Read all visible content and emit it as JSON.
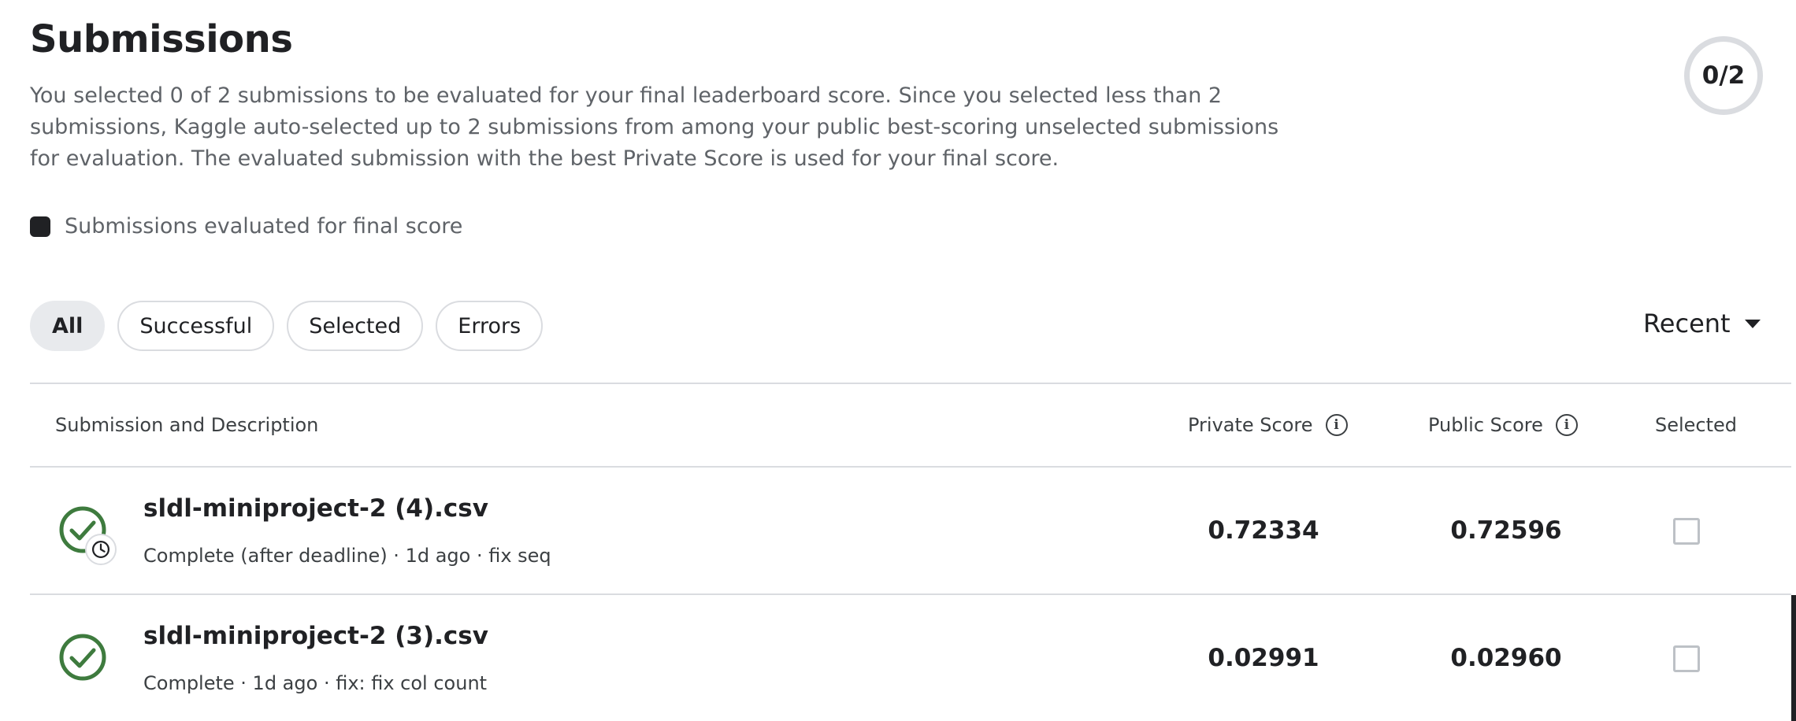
{
  "header": {
    "title": "Submissions",
    "description": "You selected 0 of 2 submissions to be evaluated for your final leaderboard score. Since you selected less than 2 submissions, Kaggle auto-selected up to 2 submissions from among your public best-scoring unselected submissions for evaluation. The evaluated submission with the best Private Score is used for your final score.",
    "counter": "0/2"
  },
  "legend": {
    "label": "Submissions evaluated for final score",
    "swatch_color": "#202124"
  },
  "filters": [
    {
      "label": "All",
      "active": true
    },
    {
      "label": "Successful",
      "active": false
    },
    {
      "label": "Selected",
      "active": false
    },
    {
      "label": "Errors",
      "active": false
    }
  ],
  "sort": {
    "label": "Recent",
    "icon": "caret-down-icon"
  },
  "table": {
    "columns": {
      "submission": "Submission and Description",
      "private_score": "Private Score",
      "public_score": "Public Score",
      "selected": "Selected"
    },
    "rows": [
      {
        "title": "sldl-miniproject-2 (4).csv",
        "meta": "Complete (after deadline) · 1d ago · fix seq",
        "private_score": "0.72334",
        "public_score": "0.72596",
        "selected": false,
        "status_icon": "check-circle-clock-icon"
      },
      {
        "title": "sldl-miniproject-2 (3).csv",
        "meta": "Complete · 1d ago · fix: fix col count",
        "private_score": "0.02991",
        "public_score": "0.02960",
        "selected": false,
        "status_icon": "check-circle-icon"
      }
    ]
  },
  "colors": {
    "success": "#3e7b3e",
    "text_primary": "#202124",
    "text_secondary": "#5f6368",
    "border": "#dadce0"
  }
}
